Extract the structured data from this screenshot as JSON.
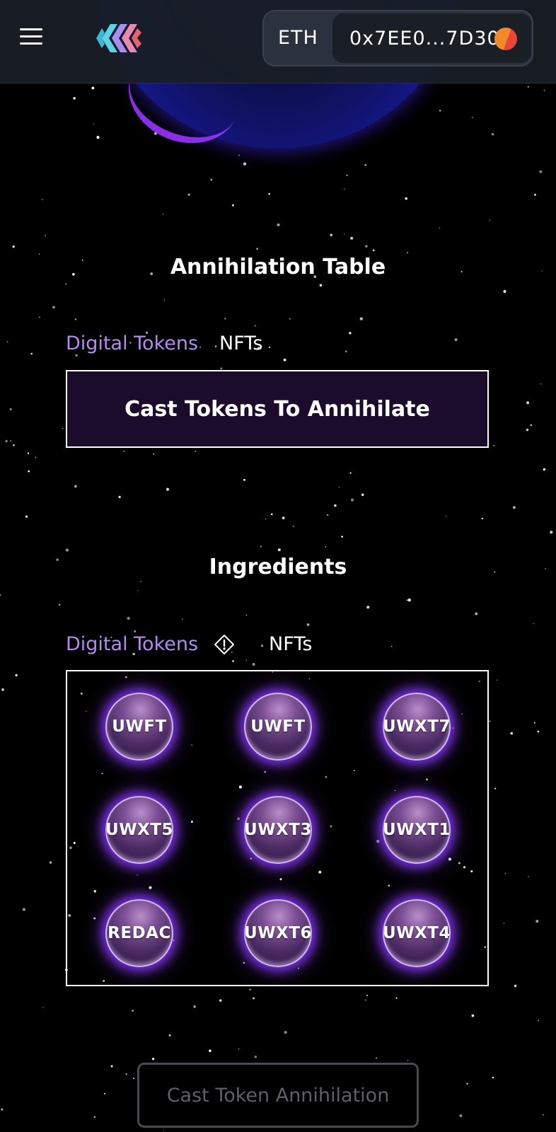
{
  "header": {
    "network": "ETH",
    "wallet_address": "0x7EE0...7D30",
    "logo_icon": "geometric-logo-icon",
    "menu_icon": "hamburger-menu-icon"
  },
  "annihilation_table": {
    "title": "Annihilation Table",
    "tabs": [
      {
        "label": "Digital Tokens",
        "active": true
      },
      {
        "label": "NFTs",
        "active": false
      }
    ],
    "cast_box_label": "Cast Tokens To Annihilate"
  },
  "ingredients": {
    "title": "Ingredients",
    "tabs": [
      {
        "label": "Digital Tokens",
        "active": true
      },
      {
        "label": "NFTs",
        "active": false
      }
    ],
    "warning_icon": "warning-diamond-icon",
    "tokens": [
      "UWFT",
      "UWFT",
      "UWXT7",
      "UWXT5",
      "UWXT3",
      "UWXT1",
      "REDAC",
      "UWXT6",
      "UWXT4"
    ]
  },
  "cta": {
    "label": "Cast Token Annihilation"
  },
  "colors": {
    "accent": "#b58af0",
    "topbar": "#191e26",
    "glow": "#7b2ff0"
  }
}
